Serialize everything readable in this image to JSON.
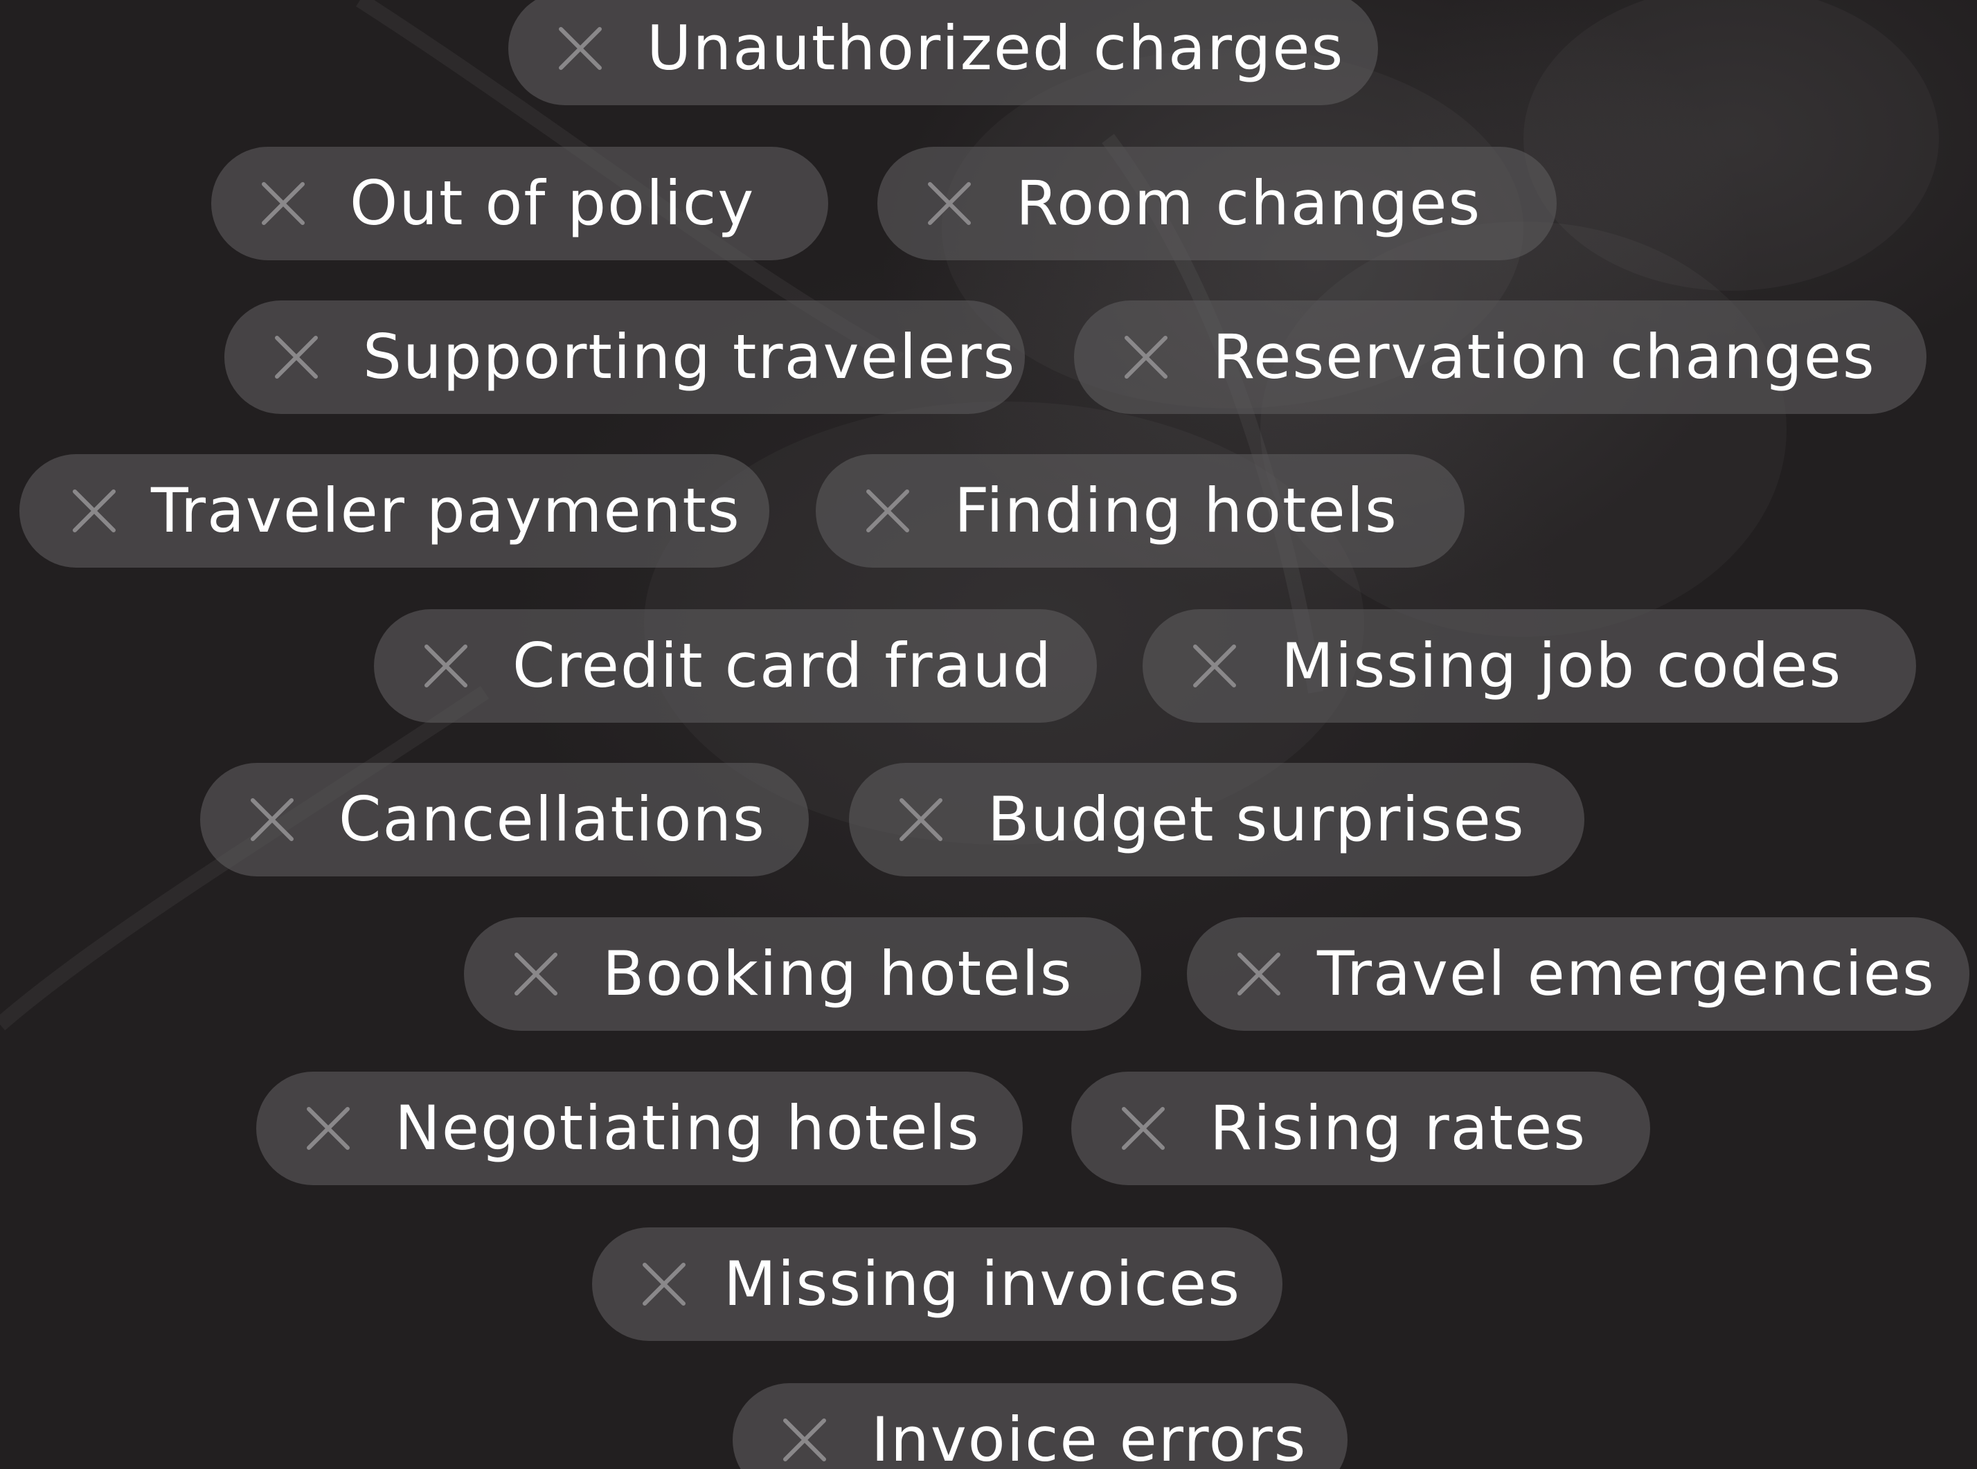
{
  "tags": [
    {
      "label": "Unauthorized charges"
    },
    {
      "label": "Out of policy"
    },
    {
      "label": "Room changes"
    },
    {
      "label": "Supporting travelers"
    },
    {
      "label": "Reservation changes"
    },
    {
      "label": "Traveler payments"
    },
    {
      "label": "Finding hotels"
    },
    {
      "label": "Credit card fraud"
    },
    {
      "label": "Missing job codes"
    },
    {
      "label": "Cancellations"
    },
    {
      "label": "Budget surprises"
    },
    {
      "label": "Booking hotels"
    },
    {
      "label": "Travel emergencies"
    },
    {
      "label": "Negotiating hotels"
    },
    {
      "label": "Rising rates"
    },
    {
      "label": "Missing invoices"
    },
    {
      "label": "Invoice errors"
    }
  ],
  "colors": {
    "background": "#221f20",
    "chip": "#5c5a5c",
    "text": "#ffffff",
    "icon": "#8a888a"
  },
  "icon": "close-icon"
}
